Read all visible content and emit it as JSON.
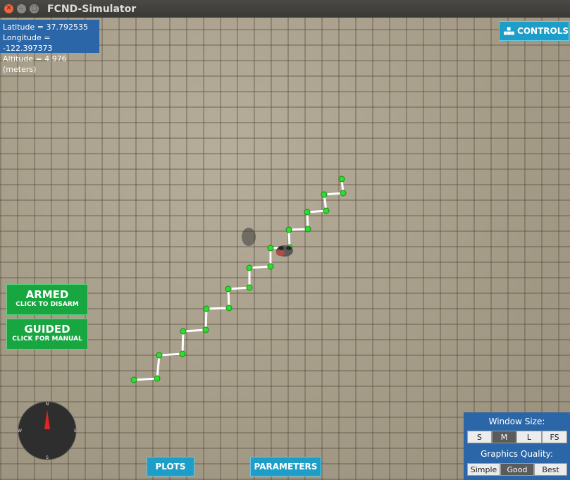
{
  "window": {
    "title": "FCND-Simulator"
  },
  "telemetry": {
    "latitude": "Latitude = 37.792535",
    "longitude": "Longitude = -122.397373",
    "altitude": "Altitude = 4.976 (meters)"
  },
  "controls_label": "CONTROLS",
  "armed": {
    "title": "ARMED",
    "sub": "CLICK TO DISARM"
  },
  "guided": {
    "title": "GUIDED",
    "sub": "CLICK FOR MANUAL"
  },
  "bottom": {
    "plots": "PLOTS",
    "parameters": "PARAMETERS"
  },
  "window_size": {
    "label": "Window Size:",
    "options": [
      "S",
      "M",
      "L",
      "FS"
    ],
    "selected": "M"
  },
  "graphics_quality": {
    "label": "Graphics Quality:",
    "options": [
      "Simple",
      "Good",
      "Best"
    ],
    "selected": "Good"
  },
  "compass": {
    "n": "N",
    "s": "S",
    "e": "E",
    "w": "W"
  },
  "colors": {
    "panel_blue": "#2b67a8",
    "button_cyan": "#1d9ec9",
    "armed_green": "#18a641",
    "waypoint_green": "#2be02b",
    "path_white": "#ffffff"
  }
}
